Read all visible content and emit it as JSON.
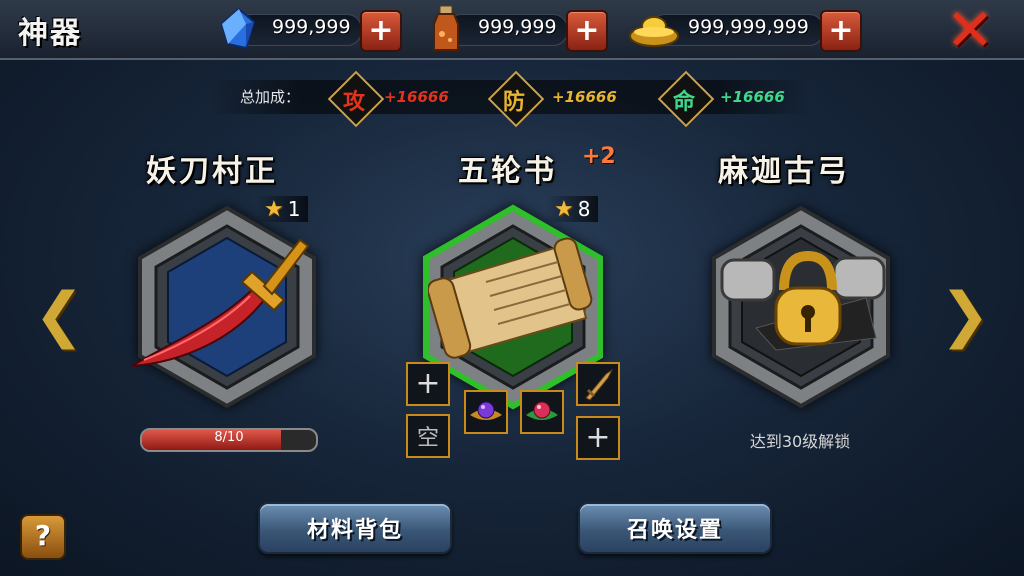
{
  "header": {
    "title": "神器",
    "currencies": [
      {
        "icon": "blue-crystal-icon",
        "value": "999,999"
      },
      {
        "icon": "potion-bottle-icon",
        "value": "999,999"
      },
      {
        "icon": "gold-ingot-icon",
        "value": "999,999,999"
      }
    ]
  },
  "bonus": {
    "label": "总加成：",
    "stats": [
      {
        "glyph": "攻",
        "value": "+16666",
        "color": "#e0341c"
      },
      {
        "glyph": "防",
        "value": "+16666",
        "color": "#e8b530"
      },
      {
        "glyph": "命",
        "value": "+16666",
        "color": "#3fd88a"
      }
    ]
  },
  "items": [
    {
      "name": "妖刀村正",
      "stars": "1",
      "progress_text": "8/10",
      "progress": 0.8
    },
    {
      "name": "五轮书",
      "stars": "8",
      "upgrade": "+2"
    },
    {
      "name": "麻迦古弓",
      "lock_text": "达到30级解锁"
    }
  ],
  "slots": {
    "empty_label": "空"
  },
  "buttons": {
    "materials": "材料背包",
    "summon": "召唤设置",
    "help": "?"
  },
  "colors": {
    "accent_gold": "#cfa836",
    "close_red": "#e0301c",
    "selected_green": "#2fbf2a"
  }
}
